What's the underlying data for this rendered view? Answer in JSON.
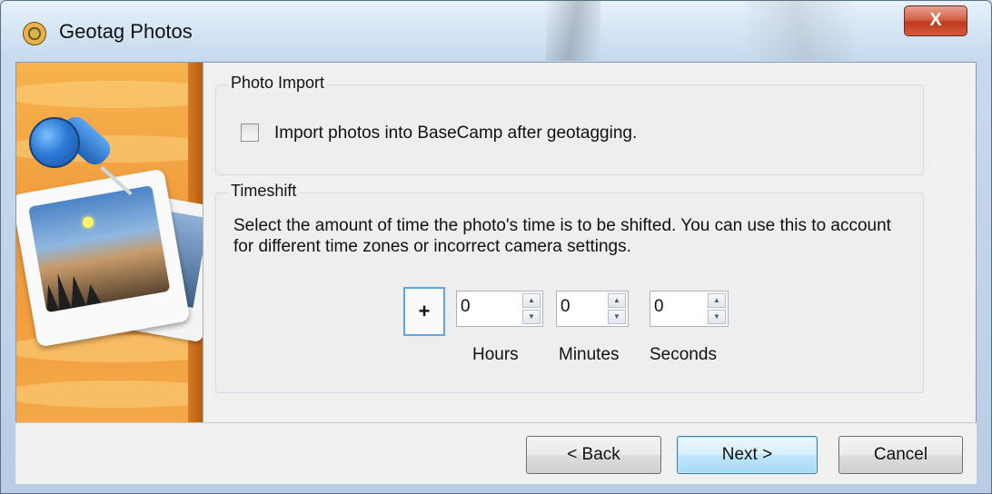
{
  "window": {
    "title": "Geotag Photos",
    "close_label": "X"
  },
  "photo_import": {
    "group_label": "Photo Import",
    "checkbox_label": "Import photos into BaseCamp after geotagging.",
    "checked": false
  },
  "timeshift": {
    "group_label": "Timeshift",
    "description": "Select the amount of time the photo's time is to be shifted. You can use this to account for different time zones or incorrect camera settings.",
    "sign": "+",
    "hours": {
      "value": "0",
      "label": "Hours"
    },
    "minutes": {
      "value": "0",
      "label": "Minutes"
    },
    "seconds": {
      "value": "0",
      "label": "Seconds"
    }
  },
  "buttons": {
    "back": "< Back",
    "next": "Next >",
    "cancel": "Cancel"
  }
}
